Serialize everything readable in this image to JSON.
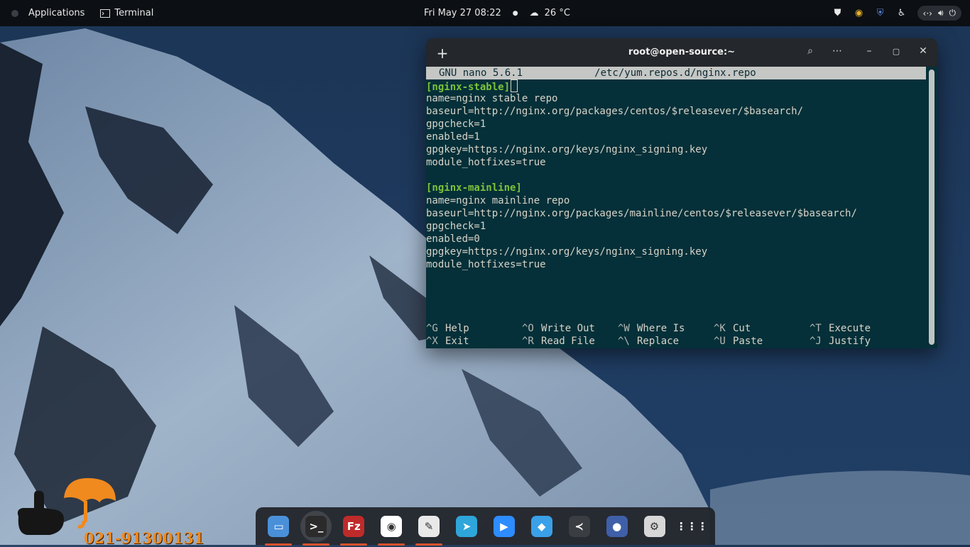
{
  "topbar": {
    "applications_label": "Applications",
    "terminal_label": "Terminal",
    "datetime": "Fri May 27  08:22",
    "weather": "26 °C"
  },
  "terminal": {
    "title": "root@open-source:~",
    "nano": {
      "header": "GNU nano 5.6.1            /etc/yum.repos.d/nginx.repo",
      "lines": [
        {
          "text": "[nginx-stable]",
          "section": true
        },
        {
          "text": "name=nginx stable repo",
          "section": false
        },
        {
          "text": "baseurl=http://nginx.org/packages/centos/$releasever/$basearch/",
          "section": false
        },
        {
          "text": "gpgcheck=1",
          "section": false
        },
        {
          "text": "enabled=1",
          "section": false
        },
        {
          "text": "gpgkey=https://nginx.org/keys/nginx_signing.key",
          "section": false
        },
        {
          "text": "module_hotfixes=true",
          "section": false
        },
        {
          "text": "",
          "section": false
        },
        {
          "text": "[nginx-mainline]",
          "section": true
        },
        {
          "text": "name=nginx mainline repo",
          "section": false
        },
        {
          "text": "baseurl=http://nginx.org/packages/mainline/centos/$releasever/$basearch/",
          "section": false
        },
        {
          "text": "gpgcheck=1",
          "section": false
        },
        {
          "text": "enabled=0",
          "section": false
        },
        {
          "text": "gpgkey=https://nginx.org/keys/nginx_signing.key",
          "section": false
        },
        {
          "text": "module_hotfixes=true",
          "section": false
        }
      ],
      "shortcuts_row1": [
        {
          "key": "^G",
          "label": "Help"
        },
        {
          "key": "^O",
          "label": "Write Out"
        },
        {
          "key": "^W",
          "label": "Where Is"
        },
        {
          "key": "^K",
          "label": "Cut"
        },
        {
          "key": "^T",
          "label": "Execute"
        }
      ],
      "shortcuts_row2": [
        {
          "key": "^X",
          "label": "Exit"
        },
        {
          "key": "^R",
          "label": "Read File"
        },
        {
          "key": "^\\",
          "label": "Replace"
        },
        {
          "key": "^U",
          "label": "Paste"
        },
        {
          "key": "^J",
          "label": "Justify"
        }
      ]
    }
  },
  "dock": {
    "apps": [
      {
        "name": "files-icon",
        "glyph": "▭",
        "color": "#4a90d9",
        "running": true
      },
      {
        "name": "terminal-icon",
        "glyph": ">_",
        "color": "#2b2b2b",
        "running": true,
        "active": true
      },
      {
        "name": "filezilla-icon",
        "glyph": "Fz",
        "color": "#bf2a2a",
        "running": true
      },
      {
        "name": "chrome-icon",
        "glyph": "◉",
        "color": "#ffffff",
        "running": true
      },
      {
        "name": "text-editor-icon",
        "glyph": "✎",
        "color": "#e9e9e9",
        "running": true
      },
      {
        "name": "telegram-icon",
        "glyph": "➤",
        "color": "#2ea6da",
        "running": false
      },
      {
        "name": "zoom-icon",
        "glyph": "▶",
        "color": "#2d8cff",
        "running": false
      },
      {
        "name": "vpn-shield-icon",
        "glyph": "◆",
        "color": "#3aa0e8",
        "running": false
      },
      {
        "name": "vscode-icon",
        "glyph": "≺",
        "color": "#3a3d41",
        "running": false
      },
      {
        "name": "mascot-app-icon",
        "glyph": "●",
        "color": "#3f5fa8",
        "running": false
      },
      {
        "name": "settings-icon",
        "glyph": "⚙",
        "color": "#d7d7d7",
        "running": false
      },
      {
        "name": "app-grid-icon",
        "glyph": "⋮⋮⋮",
        "color": "transparent",
        "running": false
      }
    ]
  },
  "logo": {
    "phone": "021-91300131"
  },
  "colors": {
    "terminal_bg": "#053039",
    "section_green": "#7cc23a",
    "accent_orange": "#f08a1e"
  }
}
